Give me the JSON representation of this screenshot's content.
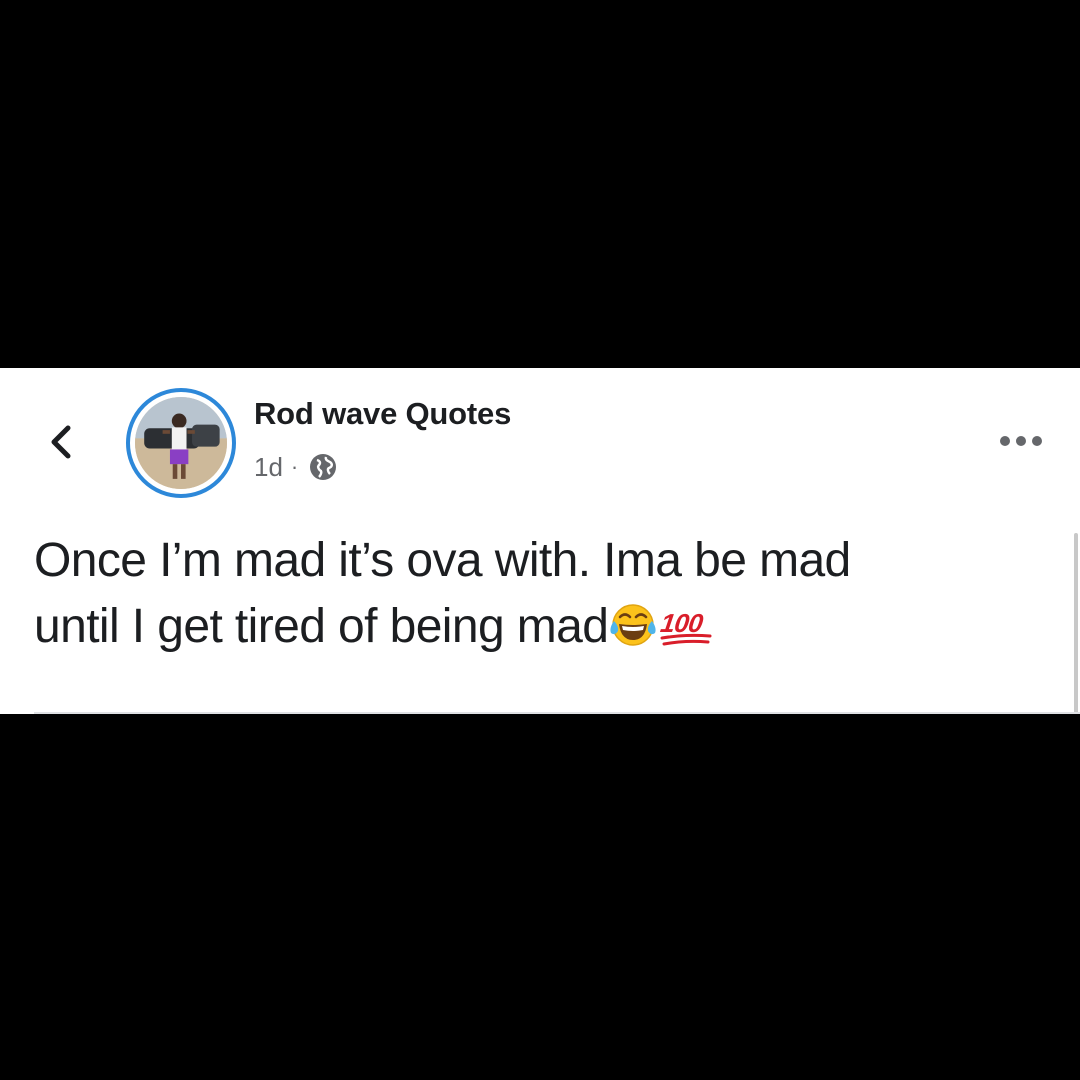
{
  "post": {
    "page_name": "Rod wave Quotes",
    "timestamp": "1d",
    "separator": "·",
    "privacy_icon": "globe-icon",
    "text_line1": "Once I’m mad it’s ova with. Ima be mad",
    "text_line2": "until I get tired of being mad",
    "emojis": [
      "face-with-tears-of-joy",
      "hundred-points"
    ]
  },
  "colors": {
    "text": "#1c1e21",
    "meta": "#65676b",
    "avatar_ring": "#2d88d9",
    "letterbox": "#000000",
    "card": "#ffffff"
  },
  "icons": {
    "back": "back-chevron-icon",
    "more": "more-options-icon"
  }
}
